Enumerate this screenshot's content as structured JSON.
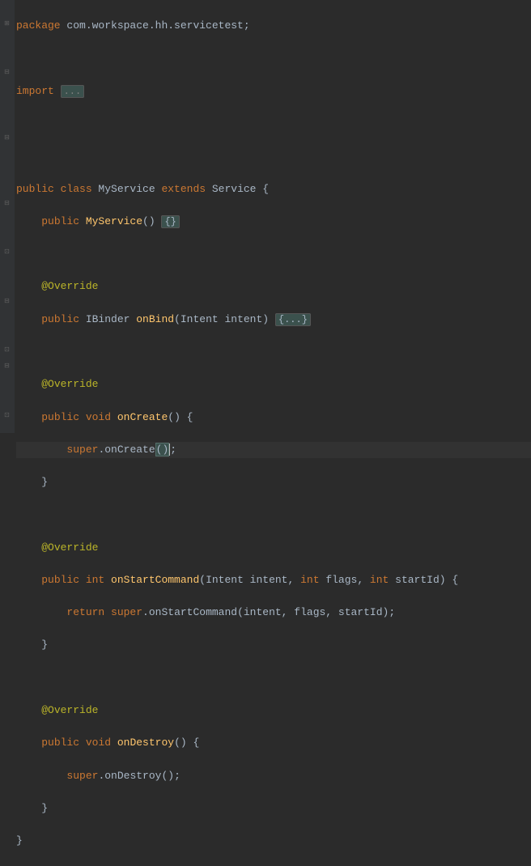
{
  "code": {
    "package_kw": "package ",
    "package_name": "com.workspace.hh.servicetest",
    "semicolon": ";",
    "import_kw": "import ",
    "import_fold": "...",
    "public_kw": "public ",
    "class_kw": "class ",
    "class_name": "MyService ",
    "extends_kw": "extends ",
    "super_class": "Service ",
    "open_brace": "{",
    "close_brace": "}",
    "constructor_name": "MyService",
    "empty_body_fold": "{}",
    "override": "@Override",
    "ibinder": "IBinder ",
    "onbind": "onBind",
    "onbind_params": "(Intent intent) ",
    "onbind_fold": "{...}",
    "void_kw": "void ",
    "int_kw": "int ",
    "oncreate": "onCreate",
    "oncreate_params": "() {",
    "super_kw": "super",
    "dot": ".",
    "oncreate_call": "onCreate",
    "oncreate_call_parens": "()",
    "onstart": "onStartCommand",
    "onstart_params": "(Intent intent, ",
    "onstart_int1": "int ",
    "onstart_p1": "flags, ",
    "onstart_int2": "int ",
    "onstart_p2": "startId) {",
    "return_kw": "return ",
    "onstart_call": "onStartCommand",
    "onstart_args": "(intent, flags, startId)",
    "ondestroy": "onDestroy",
    "ondestroy_params": "() {",
    "ondestroy_call": "onDestroy",
    "ondestroy_call_parens": "()"
  }
}
